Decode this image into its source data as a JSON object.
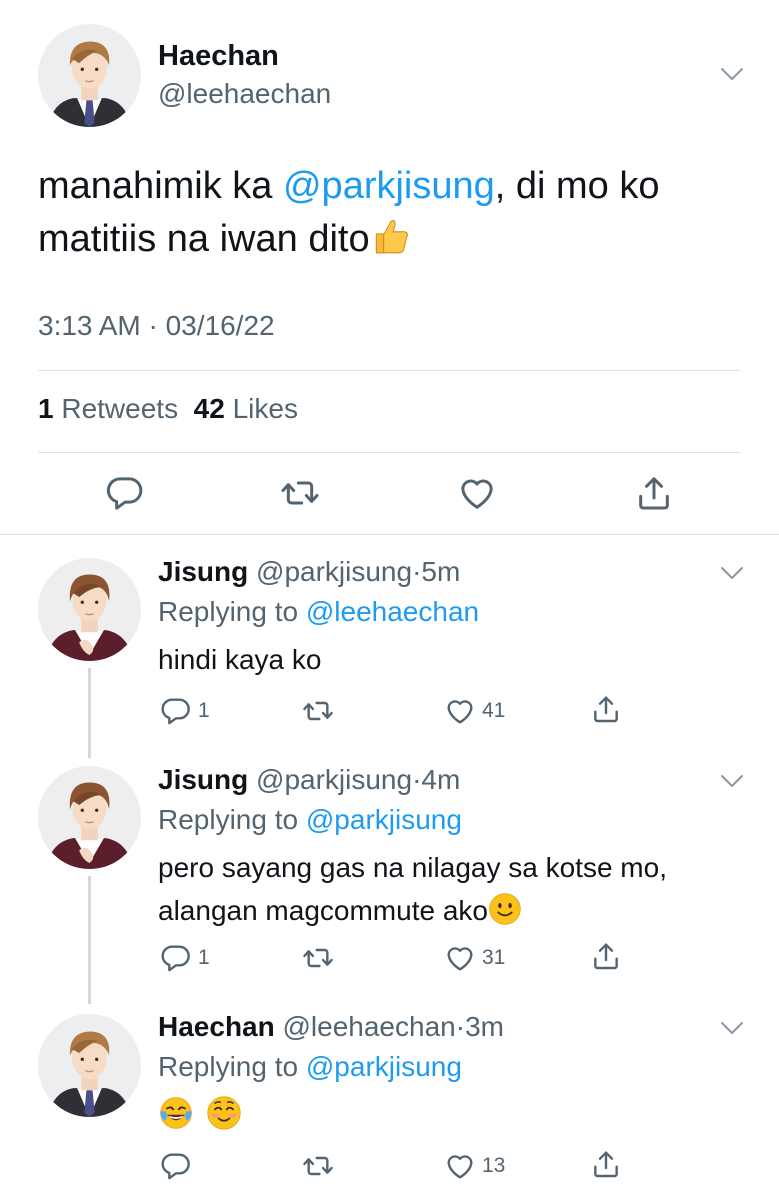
{
  "main_tweet": {
    "name": "Haechan",
    "handle": "@leehaechan",
    "text_before": "manahimik ka ",
    "mention": "@parkjisung",
    "text_after": ", di mo ko matitiis na iwan dito",
    "emoji": "thumbs-up",
    "timestamp": "3:13 AM · 03/16/22",
    "retweets_count": "1",
    "retweets_label": "Retweets",
    "likes_count": "42",
    "likes_label": "Likes"
  },
  "replies": [
    {
      "name": "Jisung",
      "handle": "@parkjisung",
      "dot": "·",
      "time": "5m",
      "replying_prefix": "Replying to ",
      "replying_to": "@leehaechan",
      "text": "hindi kaya ko",
      "reply_count": "1",
      "like_count": "41"
    },
    {
      "name": "Jisung",
      "handle": "@parkjisung",
      "dot": "·",
      "time": "4m",
      "replying_prefix": "Replying to ",
      "replying_to": "@parkjisung",
      "text_line1": "pero sayang gas na nilagay sa kotse mo,",
      "text_line2": "alangan magcommute ako",
      "emoji": "slightly-smiling-face",
      "reply_count": "1",
      "like_count": "31"
    },
    {
      "name": "Haechan",
      "handle": "@leehaechan",
      "dot": "·",
      "time": "3m",
      "replying_prefix": "Replying to ",
      "replying_to": "@parkjisung",
      "emojis": [
        "face-with-tears-of-joy",
        "smiling-face"
      ],
      "reply_count": "",
      "like_count": "13"
    }
  ],
  "colors": {
    "link": "#1d9bf0",
    "secondary_text": "#536471",
    "divider": "#dfe3e6",
    "thread_line": "#cfd9de"
  }
}
